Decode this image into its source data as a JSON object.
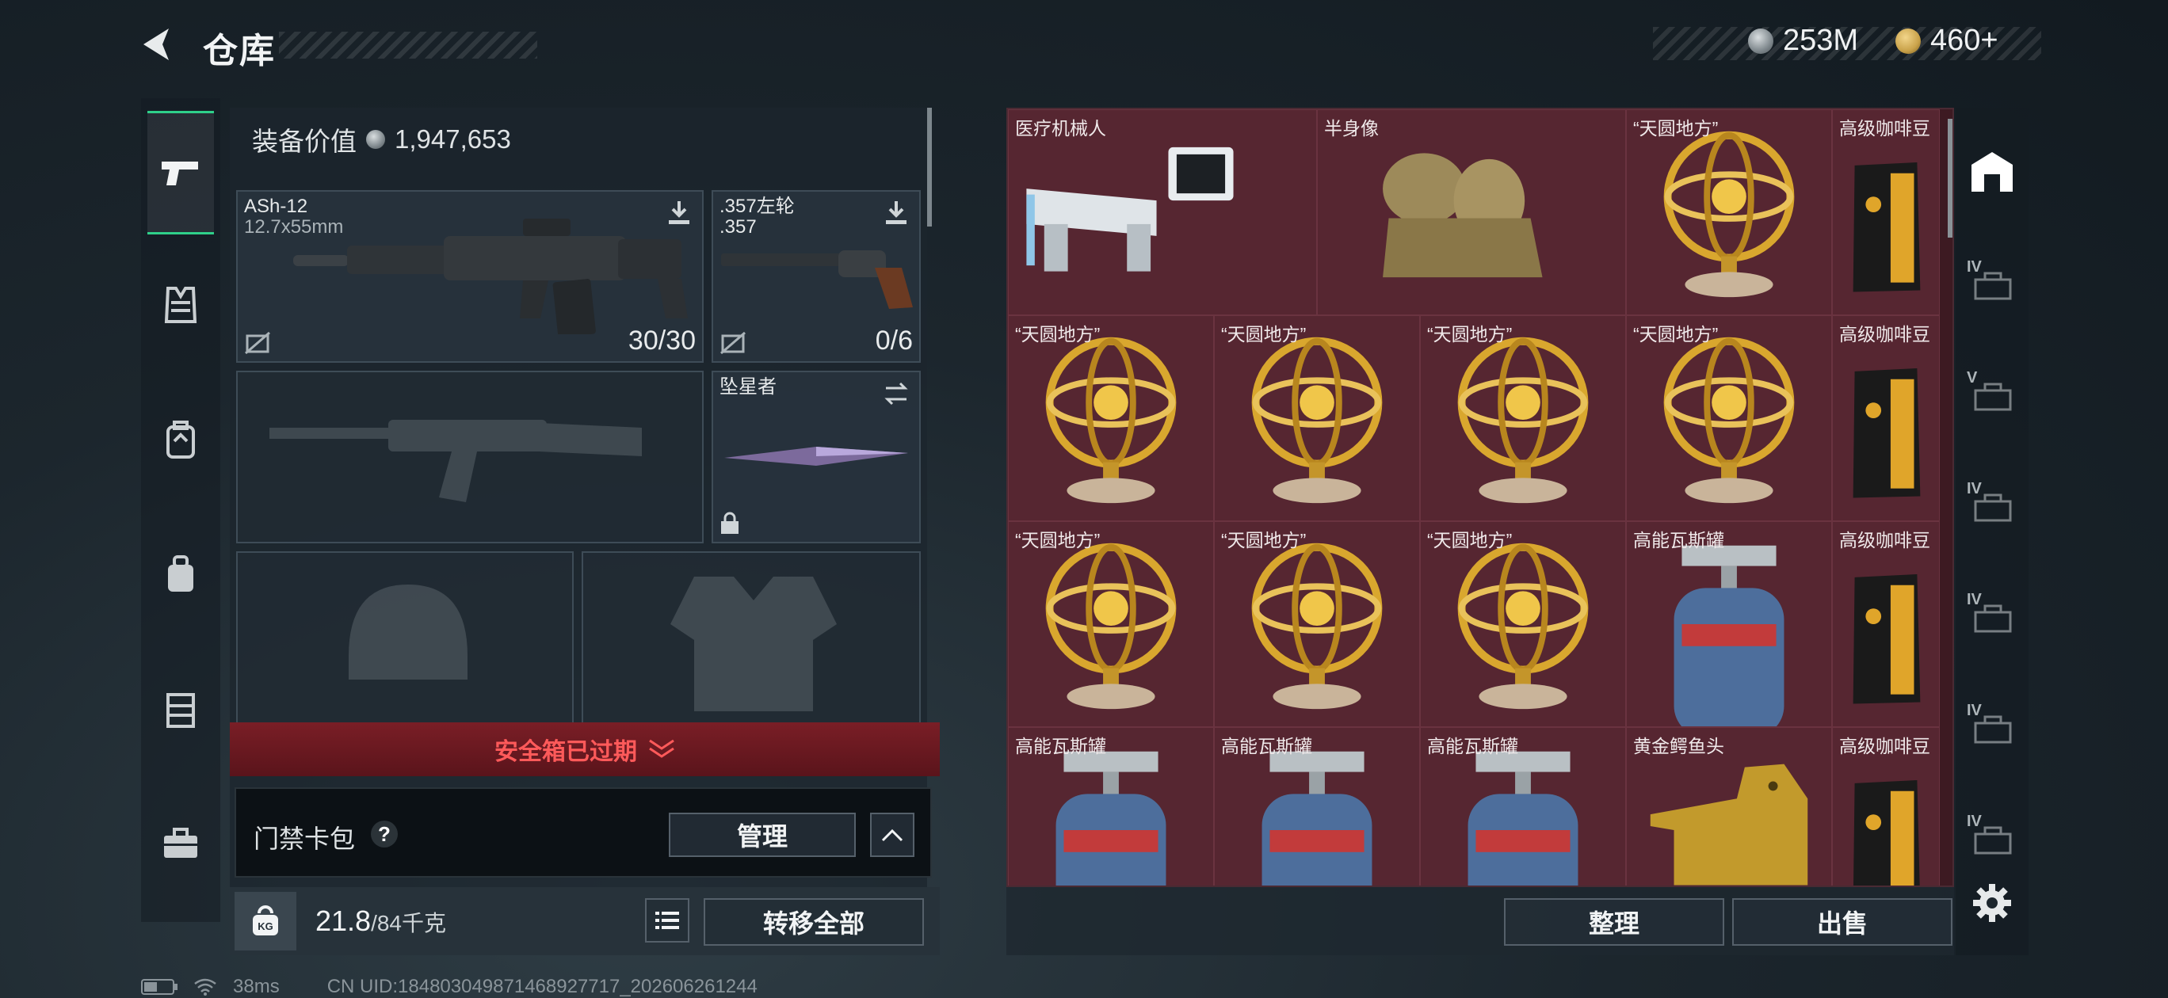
{
  "header": {
    "title": "仓库"
  },
  "currency": [
    {
      "icon": "silver-coin-icon",
      "amount": "253M",
      "color": "#9aa3a8"
    },
    {
      "icon": "gold-coin-icon",
      "amount": "460+",
      "color": "#c9a24a"
    }
  ],
  "side_tabs": [
    {
      "name": "weapons",
      "icon": "pistol-icon",
      "active": true
    },
    {
      "name": "vest",
      "icon": "vest-icon"
    },
    {
      "name": "backpack",
      "icon": "backpack-icon"
    },
    {
      "name": "bag",
      "icon": "bag-icon"
    },
    {
      "name": "container",
      "icon": "case-icon"
    },
    {
      "name": "toolbox",
      "icon": "briefcase-icon"
    }
  ],
  "loadout": {
    "value_label": "装备价值",
    "value": "1,947,653",
    "primary": {
      "name": "ASh-12",
      "caliber": "12.7x55mm",
      "ammo": "30/30"
    },
    "sidearm": {
      "name": ".357左轮",
      "caliber": ".357",
      "ammo": "0/6"
    },
    "melee": {
      "name": "坠星者"
    },
    "safebox_warning": "安全箱已过期",
    "card_pack_label": "门禁卡包",
    "help_label": "?",
    "manage_label": "管理",
    "weight": {
      "current": "21.8",
      "max": "/84千克"
    },
    "kg_label": "KG",
    "transfer_all_label": "转移全部"
  },
  "stash": {
    "items": [
      {
        "name": "医疗机械人",
        "kind": "robot"
      },
      {
        "name": "半身像",
        "kind": "bust"
      },
      {
        "name": "“天圆地方”",
        "kind": "globe"
      },
      {
        "name": "高级咖啡豆",
        "kind": "coffee"
      },
      {
        "name": "“天圆地方”",
        "kind": "globe"
      },
      {
        "name": "“天圆地方”",
        "kind": "globe"
      },
      {
        "name": "“天圆地方”",
        "kind": "globe"
      },
      {
        "name": "“天圆地方”",
        "kind": "globe"
      },
      {
        "name": "高级咖啡豆",
        "kind": "coffee"
      },
      {
        "name": "“天圆地方”",
        "kind": "globe"
      },
      {
        "name": "“天圆地方”",
        "kind": "globe"
      },
      {
        "name": "“天圆地方”",
        "kind": "globe"
      },
      {
        "name": "高能瓦斯罐",
        "kind": "gas"
      },
      {
        "name": "高级咖啡豆",
        "kind": "coffee"
      },
      {
        "name": "高能瓦斯罐",
        "kind": "gas"
      },
      {
        "name": "高能瓦斯罐",
        "kind": "gas"
      },
      {
        "name": "高能瓦斯罐",
        "kind": "gas"
      },
      {
        "name": "黄金鳄鱼头",
        "kind": "croc"
      },
      {
        "name": "高级咖啡豆",
        "kind": "coffee"
      }
    ],
    "sort_label": "整理",
    "sell_label": "出售"
  },
  "right_tabs": [
    {
      "icon": "stash-main-icon",
      "active": true
    },
    {
      "icon": "stash-tab-icon",
      "label": "IV"
    },
    {
      "icon": "stash-tab-icon",
      "label": "V"
    },
    {
      "icon": "stash-tab-icon",
      "label": "IV"
    },
    {
      "icon": "stash-tab-icon",
      "label": "IV"
    },
    {
      "icon": "stash-tab-icon",
      "label": "IV"
    },
    {
      "icon": "stash-tab-icon",
      "label": "IV"
    }
  ],
  "status_bar": {
    "ping": "38ms",
    "uid": "CN UID:184803049871468927717_202606261244"
  }
}
